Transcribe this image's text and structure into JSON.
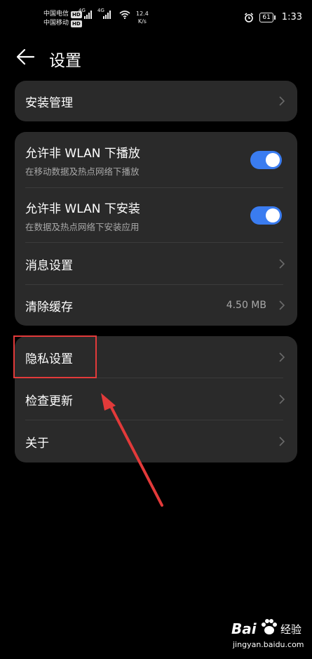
{
  "status_bar": {
    "carrier1": "中国电信",
    "carrier2": "中国移动",
    "hd_label": "HD",
    "network_label": "4G",
    "speed_value": "12.4",
    "speed_unit": "K/s",
    "battery": "61",
    "time": "1:33"
  },
  "header": {
    "title": "设置"
  },
  "group1": [
    {
      "title": "安装管理"
    }
  ],
  "group2": [
    {
      "title": "允许非 WLAN 下播放",
      "subtitle": "在移动数据及热点网络下播放",
      "toggle_on": true
    },
    {
      "title": "允许非 WLAN 下安装",
      "subtitle": "在数据及热点网络下安装应用",
      "toggle_on": true
    },
    {
      "title": "消息设置"
    },
    {
      "title": "清除缓存",
      "value": "4.50 MB"
    }
  ],
  "group3": [
    {
      "title": "隐私设置"
    },
    {
      "title": "检查更新"
    },
    {
      "title": "关于"
    }
  ],
  "colors": {
    "toggle_on": "#3a7cf0",
    "card_bg": "#2a2a2a",
    "highlight": "#e23a3a"
  },
  "watermark": {
    "brand": "Bai",
    "brand2": "经验",
    "url": "jingyan.baidu.com"
  }
}
